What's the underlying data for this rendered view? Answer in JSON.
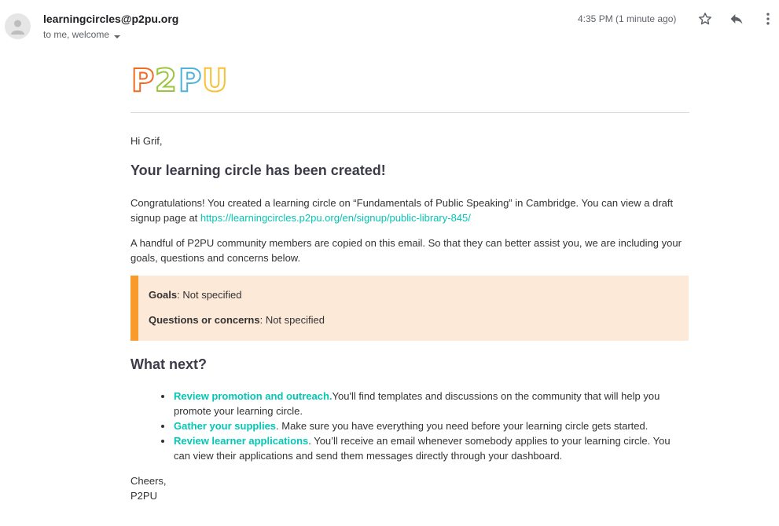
{
  "header": {
    "sender": "learningcircles@p2pu.org",
    "recipients": "to me, welcome",
    "timestamp": "4:35 PM (1 minute ago)"
  },
  "icons": {
    "avatar": "person-icon",
    "star": "star-icon",
    "reply": "reply-icon",
    "more": "more-vert-icon",
    "recipients_caret": "caret-down-icon"
  },
  "logo": {
    "text": "P2PU",
    "letters": [
      "P",
      "2",
      "P",
      "U"
    ],
    "colors": [
      "#f26a23",
      "#9bc53d",
      "#4fb3d9",
      "#f7c137"
    ]
  },
  "email": {
    "greeting": "Hi Grif,",
    "heading": "Your learning circle has been created!",
    "para1_text": "Congratulations! You created a learning circle on “Fundamentals of Public Speaking” in Cambridge. You can view a draft signup page at ",
    "signup_link": "https://learningcircles.p2pu.org/en/signup/public-library-845/",
    "para2": "A handful of P2PU community members are copied on this email. So that they can better assist you, we are including your goals, questions and concerns below.",
    "callout": {
      "goals_label": "Goals",
      "goals_value": ": Not specified",
      "questions_label": "Questions or concerns",
      "questions_value": ": Not specified"
    },
    "what_next_heading": "What next?",
    "steps": [
      {
        "title": "Review promotion and outreach.",
        "text": "You'll find templates and discussions on the community that will help you promote your learning circle."
      },
      {
        "title": "Gather your supplies",
        "text": ". Make sure you have everything you need before your learning circle gets started."
      },
      {
        "title": "Review learner applications",
        "text": ". You’ll receive an email whenever somebody applies to your learning circle. You can view their applications and send them messages directly through your dashboard."
      }
    ],
    "signoff_line1": "Cheers,",
    "signoff_line2": "P2PU"
  },
  "colors": {
    "link": "#05c6b4",
    "callout_bg": "#fde9d8",
    "callout_border": "#f99b2a",
    "heading": "#3d3d4a"
  }
}
